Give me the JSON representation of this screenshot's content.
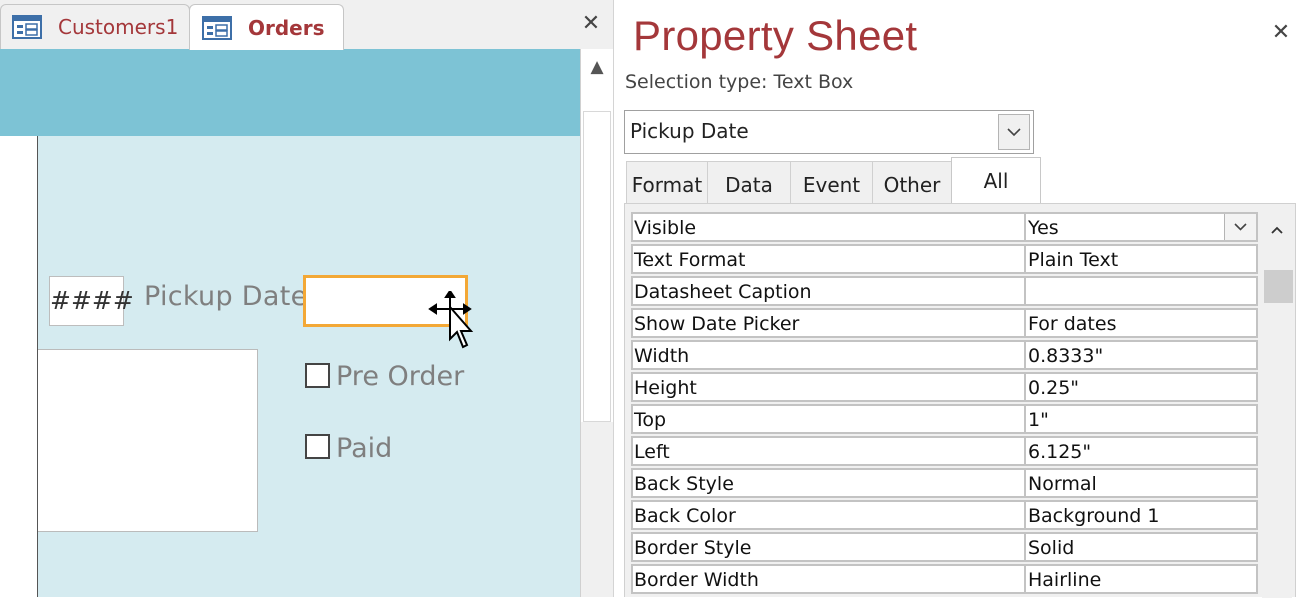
{
  "document": {
    "tabs": [
      {
        "label": "Customers1",
        "icon": "form-icon",
        "active": false
      },
      {
        "label": "Orders",
        "icon": "form-icon",
        "active": true
      }
    ],
    "close_symbol": "✕"
  },
  "form": {
    "hash_field": "####",
    "pickup_label": "Pickup Date",
    "pre_order_label": "Pre Order",
    "paid_label": "Paid",
    "header_color": "#7dc3d5",
    "detail_color": "#d5ebf0",
    "selected_border_color": "#f3a836"
  },
  "property_sheet": {
    "title": "Property Sheet",
    "close_symbol": "✕",
    "selection_type": "Selection type: Text Box",
    "selected_control": "Pickup Date",
    "tabs": [
      "Format",
      "Data",
      "Event",
      "Other",
      "All"
    ],
    "active_tab": "All",
    "properties": [
      {
        "name": "Visible",
        "value": "Yes",
        "dropdown": true
      },
      {
        "name": "Text Format",
        "value": "Plain Text"
      },
      {
        "name": "Datasheet Caption",
        "value": ""
      },
      {
        "name": "Show Date Picker",
        "value": "For dates"
      },
      {
        "name": "Width",
        "value": "0.8333\""
      },
      {
        "name": "Height",
        "value": "0.25\""
      },
      {
        "name": "Top",
        "value": "1\""
      },
      {
        "name": "Left",
        "value": "6.125\""
      },
      {
        "name": "Back Style",
        "value": "Normal"
      },
      {
        "name": "Back Color",
        "value": "Background 1"
      },
      {
        "name": "Border Style",
        "value": "Solid"
      },
      {
        "name": "Border Width",
        "value": "Hairline"
      }
    ]
  },
  "colors": {
    "accent": "#a4373a"
  }
}
